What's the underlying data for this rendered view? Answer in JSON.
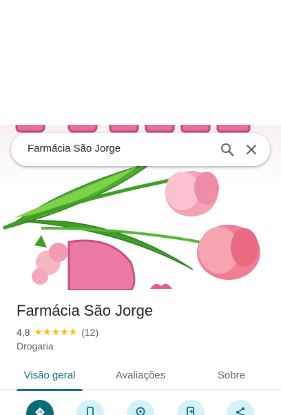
{
  "search": {
    "query": "Farmácia São Jorge"
  },
  "place": {
    "name": "Farmácia São Jorge",
    "rating": "4,8",
    "stars": "★★★★★",
    "reviews": "(12)",
    "category": "Drogaria"
  },
  "tabs": [
    {
      "label": "Visão geral",
      "active": true
    },
    {
      "label": "Avaliações",
      "active": false
    },
    {
      "label": "Sobre",
      "active": false
    }
  ],
  "icons": {
    "search": "search-icon",
    "close": "close-icon",
    "actions": [
      "directions-icon",
      "phone-icon",
      "map-pin-icon",
      "send-to-phone-icon",
      "share-icon"
    ]
  },
  "colors": {
    "accent": "#0b6b76",
    "action_bg": "#d3f1f7",
    "star": "#fbbc04"
  }
}
